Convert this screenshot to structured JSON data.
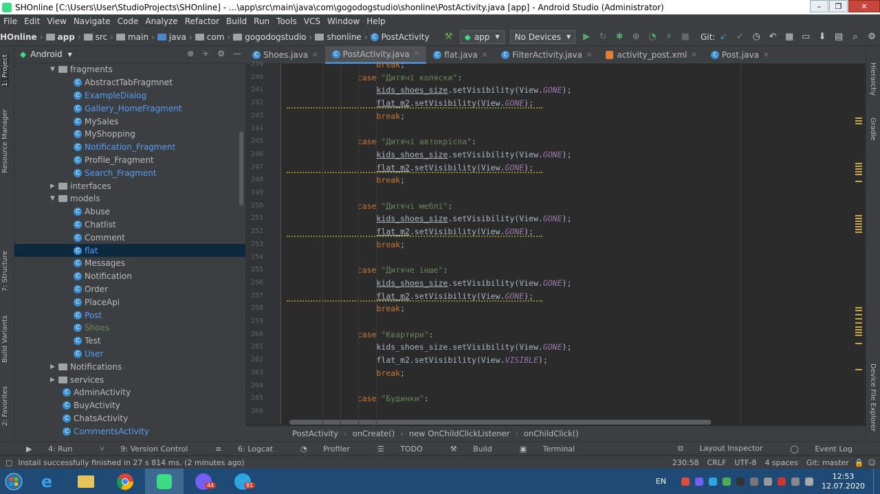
{
  "window": {
    "title": "SHOnline [C:\\Users\\User\\StudioProjects\\SHOnline] - ...\\app\\src\\main\\java\\com\\gogodogstudio\\shonline\\PostActivity.java [app] - Android Studio (Administrator)",
    "min": "–",
    "max": "❐",
    "close": "✕"
  },
  "menu": [
    "File",
    "Edit",
    "View",
    "Navigate",
    "Code",
    "Analyze",
    "Refactor",
    "Build",
    "Run",
    "Tools",
    "VCS",
    "Window",
    "Help"
  ],
  "nav": {
    "crumbs": [
      "HOnline",
      "app",
      "src",
      "main",
      "java",
      "com",
      "gogodogstudio",
      "shonline",
      "PostActivity"
    ],
    "run_config": "app",
    "devices": "No Devices",
    "git_label": "Git:"
  },
  "left_tabs": [
    "1: Project",
    "Resource Manager",
    "7: Structure",
    "Build Variants",
    "2: Favorites"
  ],
  "right_tabs": [
    "Hierarchy",
    "Gradle",
    "Device File Explorer"
  ],
  "project": {
    "view": "Android",
    "tree": [
      {
        "label": "fragments",
        "kind": "folder",
        "level": 1,
        "expanded": true
      },
      {
        "label": "AbstractTabFragmnet",
        "kind": "class",
        "level": 2
      },
      {
        "label": "ExampleDialog",
        "kind": "class",
        "level": 2,
        "color": "#589df6"
      },
      {
        "label": "Gallery_HomeFragment",
        "kind": "class",
        "level": 2,
        "color": "#589df6"
      },
      {
        "label": "MySales",
        "kind": "class",
        "level": 2
      },
      {
        "label": "MyShopping",
        "kind": "class",
        "level": 2
      },
      {
        "label": "Notification_Fragment",
        "kind": "class",
        "level": 2,
        "color": "#589df6"
      },
      {
        "label": "Profile_Fragment",
        "kind": "class",
        "level": 2
      },
      {
        "label": "Search_Fragment",
        "kind": "class",
        "level": 2,
        "color": "#589df6"
      },
      {
        "label": "interfaces",
        "kind": "folder",
        "level": 1,
        "expanded": false
      },
      {
        "label": "models",
        "kind": "folder",
        "level": 1,
        "expanded": true
      },
      {
        "label": "Abuse",
        "kind": "class",
        "level": 2
      },
      {
        "label": "Chatlist",
        "kind": "class",
        "level": 2
      },
      {
        "label": "Comment",
        "kind": "class",
        "level": 2
      },
      {
        "label": "flat",
        "kind": "class",
        "level": 2,
        "color": "#589df6",
        "selected": true
      },
      {
        "label": "Messages",
        "kind": "class",
        "level": 2
      },
      {
        "label": "Notification",
        "kind": "class",
        "level": 2
      },
      {
        "label": "Order",
        "kind": "class",
        "level": 2
      },
      {
        "label": "PlaceApi",
        "kind": "class",
        "level": 2
      },
      {
        "label": "Post",
        "kind": "class",
        "level": 2,
        "color": "#589df6"
      },
      {
        "label": "Shoes",
        "kind": "class",
        "level": 2,
        "color": "#6a8759"
      },
      {
        "label": "Test",
        "kind": "class",
        "level": 2
      },
      {
        "label": "User",
        "kind": "class",
        "level": 2,
        "color": "#589df6"
      },
      {
        "label": "Notifications",
        "kind": "folder",
        "level": 1,
        "expanded": false
      },
      {
        "label": "services",
        "kind": "folder",
        "level": 1,
        "expanded": false
      },
      {
        "label": "AdminActivity",
        "kind": "class",
        "level": 1
      },
      {
        "label": "BuyActivity",
        "kind": "class",
        "level": 1
      },
      {
        "label": "ChatsActivity",
        "kind": "class",
        "level": 1
      },
      {
        "label": "CommentsActivity",
        "kind": "class",
        "level": 1,
        "color": "#589df6"
      }
    ]
  },
  "tabs": [
    {
      "label": "Shoes.java",
      "icon": "class",
      "active": false
    },
    {
      "label": "PostActivity.java",
      "icon": "class",
      "active": true
    },
    {
      "label": "flat.java",
      "icon": "class",
      "active": false
    },
    {
      "label": "FilterActivity.java",
      "icon": "class",
      "active": false
    },
    {
      "label": "activity_post.xml",
      "icon": "xml",
      "active": false
    },
    {
      "label": "Post.java",
      "icon": "class",
      "active": false
    }
  ],
  "code": [
    {
      "n": "239",
      "t": "break"
    },
    {
      "n": "240",
      "t": "case",
      "s": "\"Дитячі коляски\""
    },
    {
      "n": "241",
      "t": "kids",
      "v": "GONE"
    },
    {
      "n": "242",
      "t": "flat",
      "v": "GONE",
      "wavy": true
    },
    {
      "n": "243",
      "t": "break"
    },
    {
      "n": "244",
      "t": "blank"
    },
    {
      "n": "245",
      "t": "case",
      "s": "\"Дитячі автокрісла\""
    },
    {
      "n": "246",
      "t": "kids",
      "v": "GONE"
    },
    {
      "n": "247",
      "t": "flat",
      "v": "GONE",
      "wavy": true
    },
    {
      "n": "248",
      "t": "break"
    },
    {
      "n": "249",
      "t": "blank"
    },
    {
      "n": "250",
      "t": "case",
      "s": "\"Дитячі меблі\""
    },
    {
      "n": "251",
      "t": "kids",
      "v": "GONE"
    },
    {
      "n": "252",
      "t": "flat",
      "v": "GONE",
      "wavy": true
    },
    {
      "n": "253",
      "t": "break"
    },
    {
      "n": "254",
      "t": "blank"
    },
    {
      "n": "255",
      "t": "case",
      "s": "\"Дитяче інше\""
    },
    {
      "n": "256",
      "t": "kids",
      "v": "GONE"
    },
    {
      "n": "257",
      "t": "flat",
      "v": "GONE",
      "wavy": true
    },
    {
      "n": "258",
      "t": "break"
    },
    {
      "n": "259",
      "t": "blank"
    },
    {
      "n": "260",
      "t": "case",
      "s": "\"Квартири\""
    },
    {
      "n": "261",
      "t": "kids",
      "v": "GONE",
      "plain": true
    },
    {
      "n": "262",
      "t": "flat",
      "v": "VISIBLE",
      "plain": true
    },
    {
      "n": "263",
      "t": "break"
    },
    {
      "n": "264",
      "t": "blank"
    },
    {
      "n": "265",
      "t": "case",
      "s": "\"Будинки\""
    },
    {
      "n": "266",
      "t": "blank"
    }
  ],
  "breadcrumbs": [
    "PostActivity",
    "onCreate()",
    "new OnChildClickListener",
    "onChildClick()"
  ],
  "bottom_tools": [
    {
      "label": "4: Run",
      "icon": "▶"
    },
    {
      "label": "9: Version Control",
      "icon": "⑂"
    },
    {
      "label": "6: Logcat",
      "icon": "≡"
    },
    {
      "label": "Profiler",
      "icon": "◔"
    },
    {
      "label": "TODO",
      "icon": "☰"
    },
    {
      "label": "Build",
      "icon": "⚒"
    },
    {
      "label": "Terminal",
      "icon": "▣"
    }
  ],
  "bottom_right": [
    "Layout Inspector",
    "Event Log"
  ],
  "status": {
    "message": "Install successfully finished in 27 s 814 ms. (2 minutes ago)",
    "position": "230:58",
    "line_sep": "CRLF",
    "encoding": "UTF-8",
    "indent": "4 spaces",
    "git": "Git: master"
  },
  "taskbar": {
    "apps": [
      {
        "name": "ie",
        "badge": ""
      },
      {
        "name": "explorer",
        "badge": ""
      },
      {
        "name": "chrome",
        "badge": ""
      },
      {
        "name": "android-studio",
        "badge": ""
      },
      {
        "name": "viber",
        "badge": "44"
      },
      {
        "name": "telegram",
        "badge": "81"
      }
    ],
    "lang": "EN",
    "time": "12:53",
    "date": "12.07.2020"
  },
  "colors": {
    "accent": "#4a88c7",
    "string": "#6a8759",
    "keyword": "#cc7832",
    "field": "#9876aa",
    "class_icon": "#3d8fd6"
  }
}
